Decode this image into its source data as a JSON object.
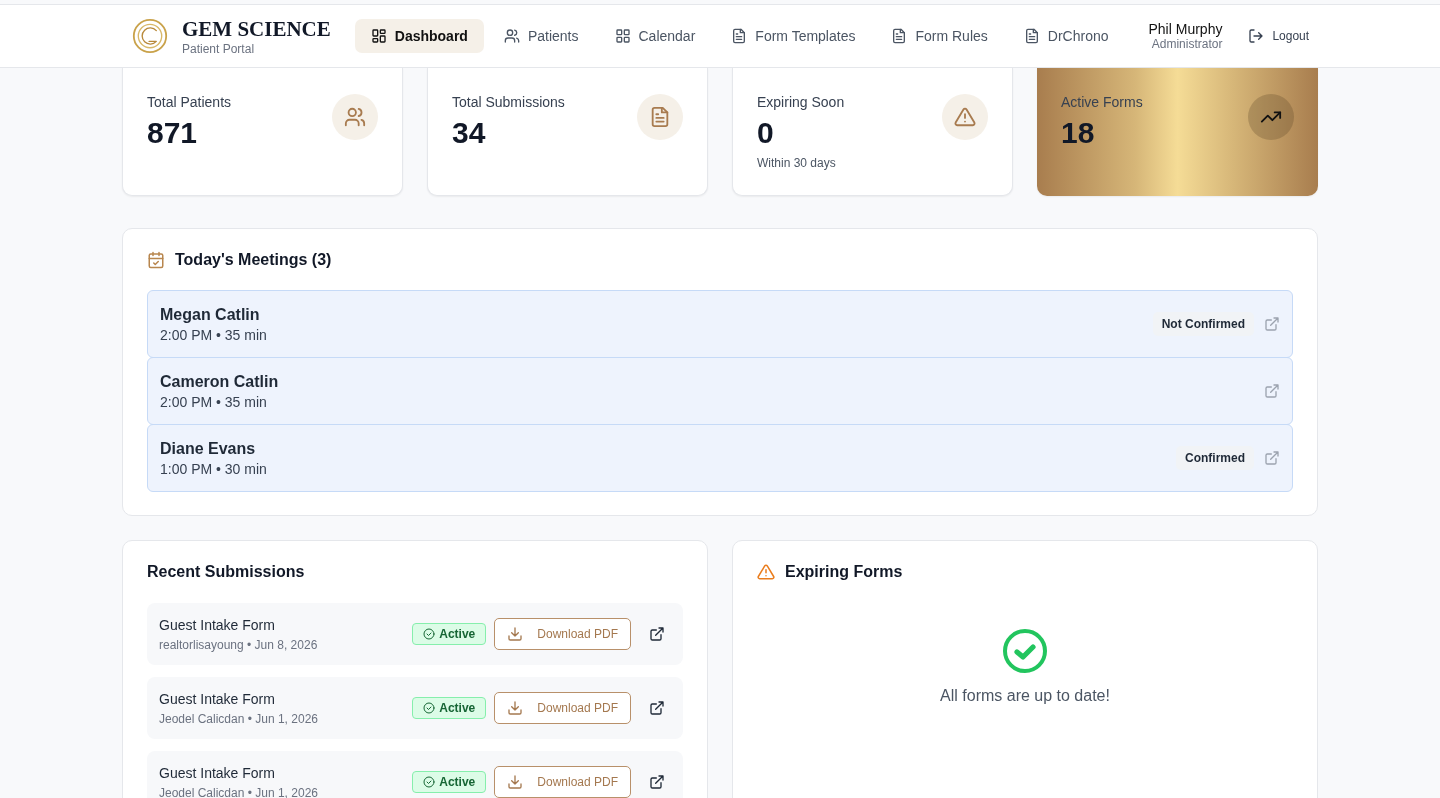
{
  "brand": {
    "name": "GEM SCIENCE",
    "subtitle": "Patient Portal"
  },
  "nav": [
    {
      "label": "Dashboard",
      "selected": true
    },
    {
      "label": "Patients",
      "selected": false
    },
    {
      "label": "Calendar",
      "selected": false
    },
    {
      "label": "Form Templates",
      "selected": false
    },
    {
      "label": "Form Rules",
      "selected": false
    },
    {
      "label": "DrChrono",
      "selected": false
    }
  ],
  "user": {
    "name": "Phil Murphy",
    "role": "Administrator"
  },
  "logout": "Logout",
  "stats": [
    {
      "label": "Total Patients",
      "value": "871",
      "kind": "plain"
    },
    {
      "label": "Total Submissions",
      "value": "34",
      "kind": "plain"
    },
    {
      "label": "Expiring Soon",
      "value": "0",
      "note": "Within 30 days",
      "kind": "plain"
    },
    {
      "label": "Active Forms",
      "value": "18",
      "kind": "gold"
    }
  ],
  "meetings": {
    "title": "Today's Meetings (3)",
    "items": [
      {
        "name": "Megan Catlin",
        "time": "2:00 PM • 35 min",
        "status": "Not Confirmed"
      },
      {
        "name": "Cameron Catlin",
        "time": "2:00 PM • 35 min"
      },
      {
        "name": "Diane Evans",
        "time": "1:00 PM • 30 min",
        "status": "Confirmed"
      }
    ]
  },
  "submissions": {
    "title": "Recent Submissions",
    "items": [
      {
        "form": "Guest Intake Form",
        "meta": "realtorlisayoung • Jun 8, 2026",
        "status": "Active",
        "action": "Download PDF"
      },
      {
        "form": "Guest Intake Form",
        "meta": "Jeodel Calicdan • Jun 1, 2026",
        "status": "Active",
        "action": "Download PDF"
      },
      {
        "form": "Guest Intake Form",
        "meta": "Jeodel Calicdan • Jun 1, 2026",
        "status": "Active",
        "action": "Download PDF"
      }
    ]
  },
  "expiring": {
    "title": "Expiring Forms",
    "empty": "All forms are up to date!"
  }
}
